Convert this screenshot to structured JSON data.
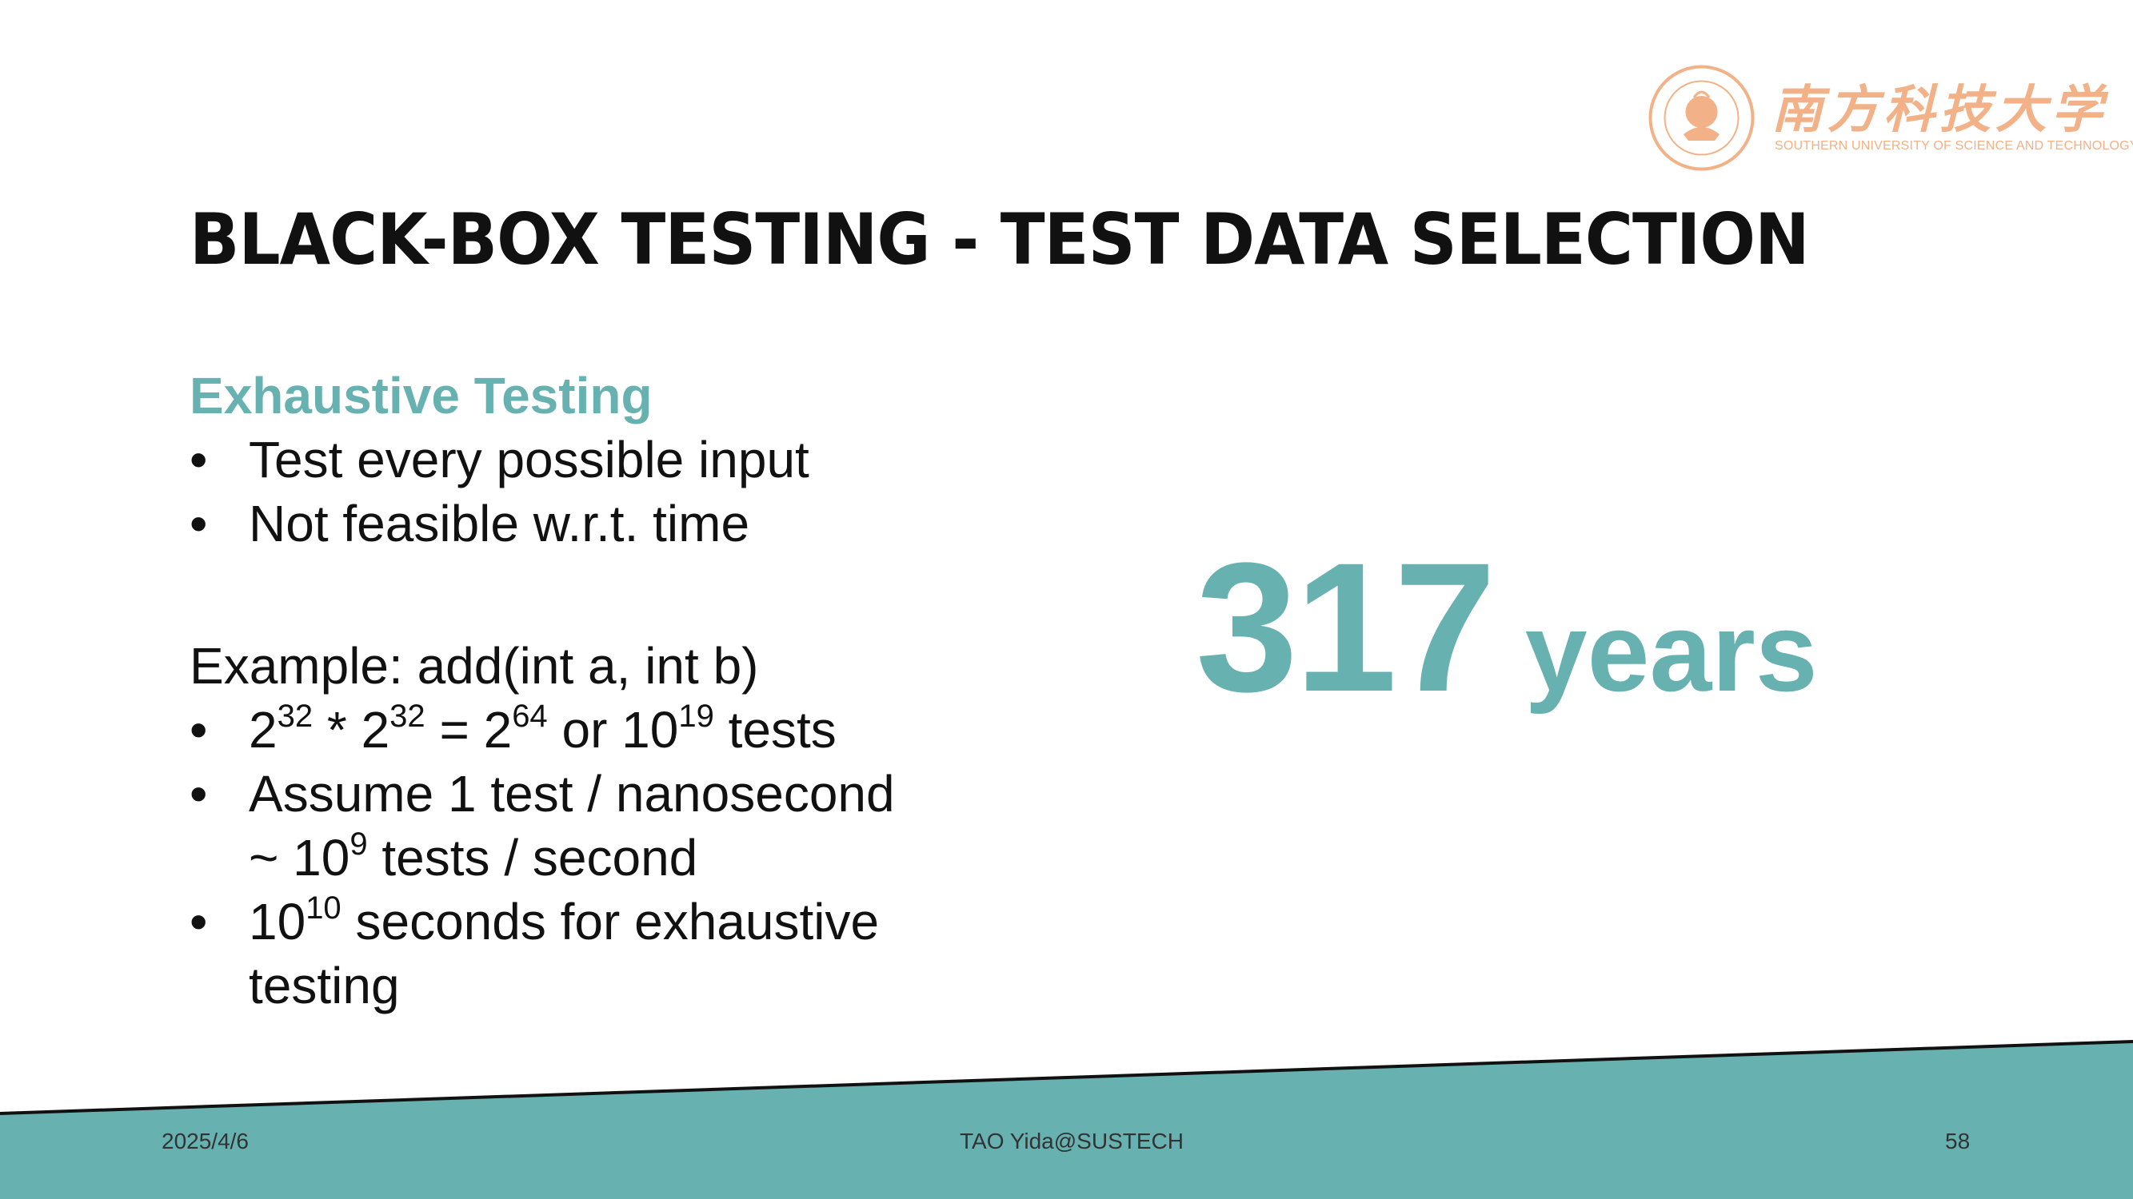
{
  "slide": {
    "title": "Black-box Testing - Test Data Selection",
    "colors": {
      "accent": "#67b1b0",
      "text": "#111111",
      "logo": "#f2b187",
      "footer_band": "#67b1b0"
    }
  },
  "logo": {
    "chinese_name": "南方科技大学",
    "english_name": "SOUTHERN UNIVERSITY OF SCIENCE AND TECHNOLOGY",
    "emblem_icon": "university-seal-icon"
  },
  "content": {
    "heading": "Exhaustive Testing",
    "bullets": [
      "Test every possible input",
      "Not feasible w.r.t. time"
    ],
    "example": {
      "label": "Example: add(int a, int b)",
      "b1": {
        "base1": "2",
        "exp1": "32",
        "mid1": " * 2",
        "exp2": "32",
        "mid2": " = 2",
        "exp3": "64",
        "mid3": " or 10",
        "exp4": "19",
        "tail": " tests"
      },
      "b2": {
        "line1": "Assume 1 test / nanosecond",
        "line2_pre": "~ 10",
        "line2_exp": "9",
        "line2_post": " tests / second"
      },
      "b3": {
        "pre": "10",
        "exp": "10",
        "post": " seconds for exhaustive testing"
      }
    }
  },
  "highlight": {
    "number": "317",
    "unit": "years"
  },
  "footer": {
    "date": "2025/4/6",
    "author": "TAO Yida@SUSTECH",
    "page": "58"
  }
}
